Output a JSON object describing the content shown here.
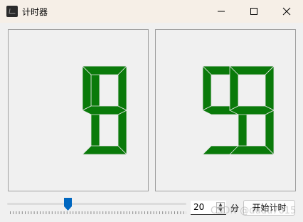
{
  "window": {
    "title": "计时器"
  },
  "display": {
    "minutes": "19",
    "seconds": "59",
    "digit_color": "#0a7a0a"
  },
  "slider": {
    "value": 20
  },
  "spin": {
    "value": "20",
    "up_arrow": "▲",
    "down_arrow": "▼"
  },
  "unit_label": "分",
  "start_label": "开始计时",
  "watermark": "CSDN @dudu7615",
  "icons": {
    "app": "timer-app-icon",
    "minimize": "minimize-icon",
    "maximize": "maximize-icon",
    "close": "close-icon"
  }
}
